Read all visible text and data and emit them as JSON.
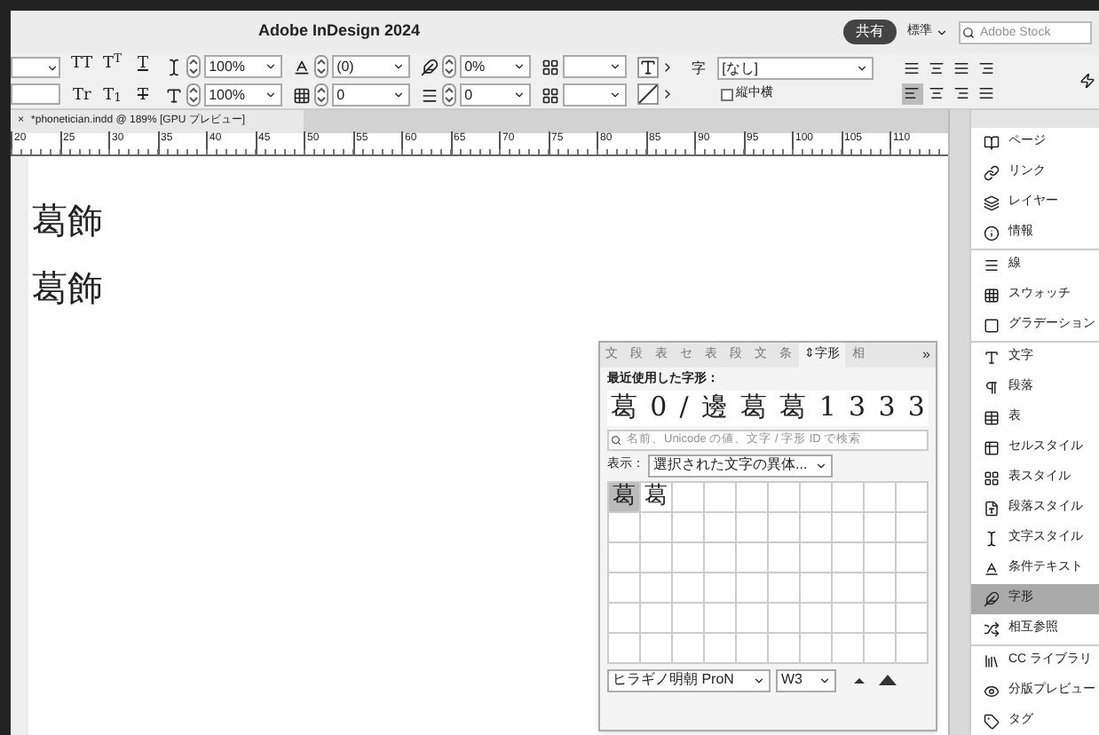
{
  "window": {
    "title": "Adobe InDesign 2024"
  },
  "header": {
    "share": "共有",
    "workspace": "標準",
    "search": {
      "placeholder": "Adobe Stock"
    }
  },
  "toolbar": {
    "style_buttons": [
      {
        "text": "TT",
        "kind": "plain"
      },
      {
        "text": "T$^{T}$",
        "kind": "plain"
      },
      {
        "text": "T",
        "kind": "underline"
      },
      {
        "text": "Tr",
        "kind": "plain"
      },
      {
        "text": "T$_{1}$",
        "kind": "plain"
      },
      {
        "text": "T",
        "kind": "strike"
      }
    ],
    "vertical_scale": "100%",
    "horizontal_scale": "100%",
    "kerning": "(0)",
    "tracking": "0",
    "tsume": "0%",
    "aki": "0",
    "char_style": "[なし]",
    "char_style_label": "字",
    "tatechuyoko": {
      "label": "縦中横",
      "checked": false
    },
    "align_buttons": [
      {
        "selected": false
      },
      {
        "selected": false
      },
      {
        "selected": false
      },
      {
        "selected": false
      },
      {
        "selected": true
      },
      {
        "selected": false
      },
      {
        "selected": false
      },
      {
        "selected": false
      }
    ]
  },
  "document_tab": {
    "close": "×",
    "title": "*phonetician.indd @ 189% [GPU プレビュー]"
  },
  "ruler": [
    "20",
    "25",
    "30",
    "35",
    "40",
    "45",
    "50",
    "55",
    "60",
    "65",
    "70",
    "75",
    "80",
    "85",
    "90",
    "95",
    "100",
    "105",
    "110"
  ],
  "document_text": [
    "葛飾",
    "葛飾"
  ],
  "glyphs_panel": {
    "tabs": [
      {
        "label": "文",
        "selected": false
      },
      {
        "label": "段",
        "selected": false
      },
      {
        "label": "表",
        "selected": false
      },
      {
        "label": "セ",
        "selected": false
      },
      {
        "label": "表",
        "selected": false
      },
      {
        "label": "段",
        "selected": false
      },
      {
        "label": "文",
        "selected": false
      },
      {
        "label": "条",
        "selected": false
      },
      {
        "label": "⇕字形",
        "selected": true
      },
      {
        "label": "相",
        "selected": false
      }
    ],
    "more": "»",
    "recent_label": "最近使用した字形：",
    "recent": [
      "葛",
      "0",
      "/",
      "邊",
      "葛",
      "葛",
      "1",
      "3",
      "3",
      "3"
    ],
    "search": {
      "placeholder": "名前、Unicode の値、文字 / 字形 ID で検索"
    },
    "show_label": "表示：",
    "show_value": "選択された文字の異体...",
    "grid": [
      {
        "glyph": "葛",
        "selected": true
      },
      {
        "glyph": "葛",
        "selected": false
      }
    ],
    "font": "ヒラギノ明朝 ProN",
    "weight": "W3"
  },
  "panels": [
    [
      {
        "label": "ページ",
        "selected": false
      },
      {
        "label": "リンク",
        "selected": false
      },
      {
        "label": "レイヤー",
        "selected": false
      },
      {
        "label": "情報",
        "selected": false
      }
    ],
    [
      {
        "label": "線",
        "selected": false
      },
      {
        "label": "スウォッチ",
        "selected": false
      },
      {
        "label": "グラデーション",
        "selected": false
      }
    ],
    [
      {
        "label": "文字",
        "selected": false
      },
      {
        "label": "段落",
        "selected": false
      },
      {
        "label": "表",
        "selected": false
      },
      {
        "label": "セルスタイル",
        "selected": false
      },
      {
        "label": "表スタイル",
        "selected": false
      },
      {
        "label": "段落スタイル",
        "selected": false
      },
      {
        "label": "文字スタイル",
        "selected": false
      },
      {
        "label": "条件テキスト",
        "selected": false
      },
      {
        "label": "字形",
        "selected": true
      },
      {
        "label": "相互参照",
        "selected": false
      }
    ],
    [
      {
        "label": "CC ライブラリ",
        "selected": false
      },
      {
        "label": "分版プレビュー",
        "selected": false
      },
      {
        "label": "タグ",
        "selected": false
      }
    ]
  ]
}
